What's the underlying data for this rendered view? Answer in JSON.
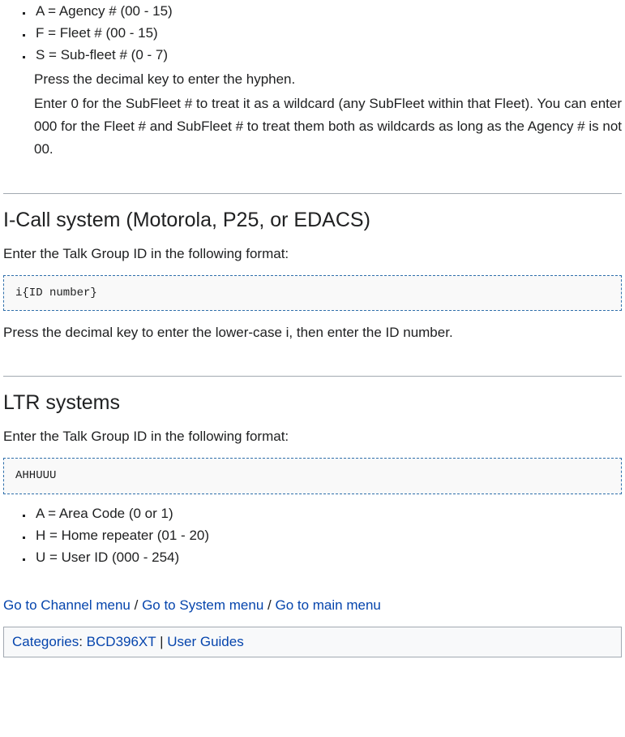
{
  "topList": {
    "items": [
      "A = Agency # (00 - 15)",
      "F = Fleet # (00 - 15)",
      "S = Sub-fleet # (0 - 7)"
    ],
    "after": [
      "Press the decimal key to enter the hyphen.",
      "Enter 0 for the SubFleet # to treat it as a wildcard (any SubFleet within that Fleet). You can enter 000 for the Fleet # and SubFleet # to treat them both as wildcards as long as the Agency # is not 00."
    ]
  },
  "icall": {
    "heading": "I-Call system (Motorola, P25, or EDACS)",
    "intro": "Enter the Talk Group ID in the following format:",
    "code": "i{ID number}",
    "after": "Press the decimal key to enter the lower-case i, then enter the ID number."
  },
  "ltr": {
    "heading": "LTR systems",
    "intro": "Enter the Talk Group ID in the following format:",
    "code": "AHHUUU",
    "items": [
      "A = Area Code (0 or 1)",
      "H = Home repeater (01 - 20)",
      "U = User ID (000 - 254)"
    ]
  },
  "nav": {
    "channel": "Go to Channel menu",
    "system": "Go to System menu",
    "main": "Go to main menu",
    "sep": " / "
  },
  "catbox": {
    "label": "Categories",
    "colon": ": ",
    "cat1": "BCD396XT",
    "sep": " | ",
    "cat2": "User Guides"
  }
}
